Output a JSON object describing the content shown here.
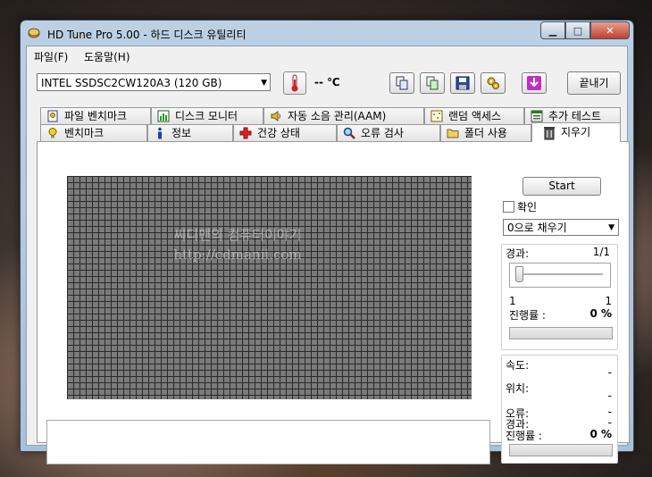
{
  "window": {
    "title": "HD Tune Pro 5.00 - 하드 디스크 유틸리티"
  },
  "menu": {
    "file": "파일(F)",
    "help": "도움말(H)"
  },
  "toolbar": {
    "drive": "INTEL SSDSC2CW120A3 (120 GB)",
    "temperature": "-- ℃",
    "exit_label": "끝내기"
  },
  "tabs_top": [
    {
      "label": "파일 벤치마크"
    },
    {
      "label": "디스크 모니터"
    },
    {
      "label": "자동 소음 관리(AAM)"
    },
    {
      "label": "랜덤 액세스"
    },
    {
      "label": "추가 테스트"
    }
  ],
  "tabs_bottom": [
    {
      "label": "벤치마크"
    },
    {
      "label": "정보"
    },
    {
      "label": "건강 상태"
    },
    {
      "label": "오류 검사"
    },
    {
      "label": "폴더 사용"
    },
    {
      "label": "지우기",
      "active": true
    }
  ],
  "erase": {
    "start_label": "Start",
    "confirm_label": "확인",
    "fill_option": "0으로 채우기",
    "pass_label": "경과:",
    "pass_value": "1/1",
    "slider_min": "1",
    "slider_max": "1",
    "slider_level": 0,
    "progress_label": "진행률 :",
    "progress_value": "0 %",
    "progress_fraction": 0
  },
  "stats": {
    "speed_label": "속도:",
    "speed_value": "-",
    "position_label": "위치:",
    "position_value": "-",
    "error_label": "오류:",
    "error_value": "-",
    "elapsed_label": "경과:",
    "elapsed_value": "-",
    "progress_label": "진행률 :",
    "progress_value": "0 %",
    "progress_fraction": 0
  },
  "watermark": {
    "line1": "씨디맨의 컴퓨터이야기",
    "line2": "http://cdmanii.com"
  }
}
